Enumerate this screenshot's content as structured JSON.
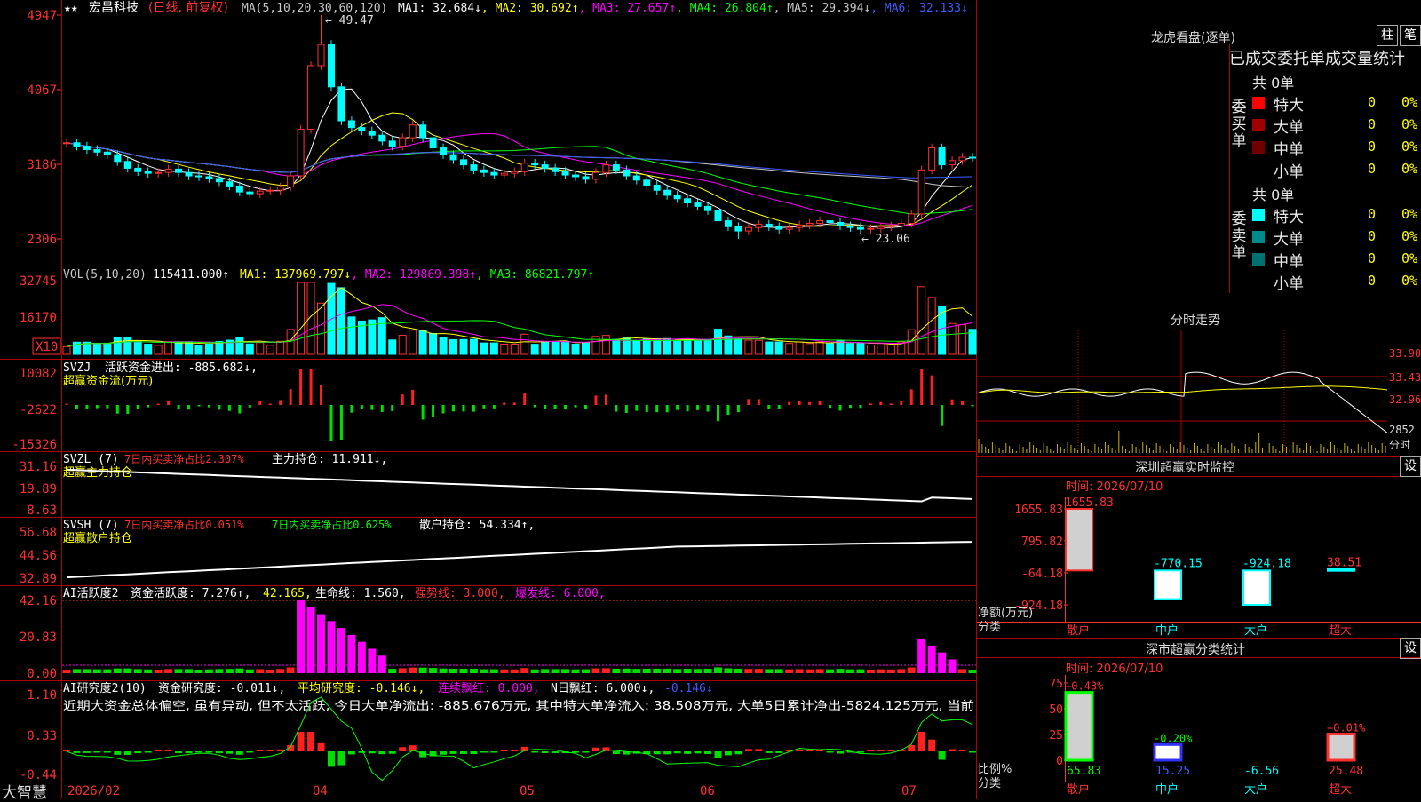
{
  "stock": {
    "name": "宏昌科技",
    "mode": "(日线, 前复权)"
  },
  "main": {
    "ma_param": "MA(5,10,20,30,60,120)",
    "ma": [
      {
        "label": "MA1: 32.684↓",
        "color": "#ffffff"
      },
      {
        "label": "MA2: 30.692↑",
        "color": "#ffff00"
      },
      {
        "label": "MA3: 27.657↑",
        "color": "#ff00ff"
      },
      {
        "label": "MA4: 26.804↑",
        "color": "#00ff00"
      },
      {
        "label": "MA5: 29.394↓",
        "color": "#c8c8c8"
      },
      {
        "label": "MA6: 32.133↓",
        "color": "#3c5cff"
      }
    ],
    "y_ticks": [
      "4947",
      "4067",
      "3186",
      "2306"
    ],
    "high_label": "49.47",
    "low_label": "23.06",
    "star_marks": "★★"
  },
  "vol": {
    "title": "VOL(5,10,20)",
    "value": "115411.000↑",
    "ma": [
      {
        "label": "MA1: 137969.797↓",
        "color": "#ffff00"
      },
      {
        "label": "MA2: 129869.398↑",
        "color": "#ff00ff"
      },
      {
        "label": "MA3: 86821.797↑",
        "color": "#00ff00"
      }
    ],
    "y_ticks": [
      "32745",
      "16170"
    ],
    "unit": "X10"
  },
  "svzj": {
    "title": "SVZJ",
    "line1": "活跃资金进出: -885.682↓,",
    "line2": "超赢资金流(万元)",
    "y_ticks": [
      "10082",
      "-2622",
      "-15326"
    ]
  },
  "svzl": {
    "title": "SVZL (7)",
    "seg1": "7日内买卖净占比2.307%",
    "seg2": "主力持仓: 11.911↓,",
    "line2": "超赢主力持仓",
    "y_ticks": [
      "31.16",
      "19.89",
      "8.63"
    ]
  },
  "svsh": {
    "title": "SVSH (7)",
    "seg1": "7日内买卖净占比0.051%",
    "seg2": "7日内买卖净占比0.625%",
    "seg3": "散户持仓: 54.334↑,",
    "line2": "超赢散户持仓",
    "y_ticks": [
      "56.68",
      "44.56",
      "32.89"
    ]
  },
  "ai1": {
    "title": "AI活跃度2",
    "seg1": "资金活跃度: 7.276↑,",
    "seg2": "42.165,",
    "seg3": "生命线: 1.560,",
    "seg4": "强势线: 3.000,",
    "seg5": "爆发线: 6.000,",
    "y_ticks": [
      "42.16",
      "20.83",
      "0.00"
    ]
  },
  "ai2": {
    "title": "AI研究度2(10)",
    "seg1": "资金研究度: -0.011↓,",
    "seg2": "平均研究度: -0.146↓,",
    "seg3": "连续飘红: 0.000,",
    "seg4": "N日飘红: 6.000↓,",
    "seg5": "-0.146↓",
    "comment": "近期大资金总体偏空, 虽有异动, 但不太活跃, 今日大单净流出: -885.676万元, 其中特大单净流入: 38.508万元, 大单5日累计净出-5824.125万元, 当前",
    "y_ticks": [
      "1.10",
      "0.33",
      "-0.44"
    ]
  },
  "x_axis": [
    "2026/02",
    "04",
    "05",
    "06",
    "07"
  ],
  "brand": "大智慧",
  "right": {
    "dragon_title": "龙虎看盘(逐单)",
    "btn_bar": "柱",
    "btn_bi": "笔",
    "order_header": "已成交委托单成交量统计",
    "buy": {
      "side": "委买单",
      "total": "共 0单",
      "rows": [
        {
          "name": "特大",
          "count": "0",
          "pct": "0%",
          "color": "#ff0000"
        },
        {
          "name": "大单",
          "count": "0",
          "pct": "0%",
          "color": "#a00000"
        },
        {
          "name": "中单",
          "count": "0",
          "pct": "0%",
          "color": "#700000"
        },
        {
          "name": "小单",
          "count": "0",
          "pct": "0%",
          "color": ""
        }
      ]
    },
    "sell": {
      "side": "委卖单",
      "total": "共 0单",
      "rows": [
        {
          "name": "特大",
          "count": "0",
          "pct": "0%",
          "color": "#00ffff"
        },
        {
          "name": "大单",
          "count": "0",
          "pct": "0%",
          "color": "#008b8b"
        },
        {
          "name": "中单",
          "count": "0",
          "pct": "0%",
          "color": "#007070"
        },
        {
          "name": "小单",
          "count": "0",
          "pct": "0%",
          "color": ""
        }
      ]
    },
    "intraday_title": "分时走势",
    "intraday_ticks": [
      "33.90",
      "33.43",
      "32.96"
    ],
    "intraday_vol_label": "2852",
    "intraday_tag": "分时",
    "monitor_title": "深圳超赢实时监控",
    "monitor_date": "时间: 2026/07/10",
    "monitor_yticks": [
      "1655.83",
      "795.82",
      "-64.18",
      "-924.18"
    ],
    "monitor_ylabel1": "净额(万元)",
    "monitor_ylabel2": "分类",
    "monitor_values": [
      {
        "label": "1655.83",
        "cat": "散户",
        "value": 1655.83
      },
      {
        "label": "-770.15",
        "cat": "中户",
        "value": -770.15
      },
      {
        "label": "-924.18",
        "cat": "大户",
        "value": -924.18
      },
      {
        "label": "38.51",
        "cat": "超大",
        "value": 38.51
      }
    ],
    "stat_title": "深市超赢分类统计",
    "stat_date": "时间: 2026/07/10",
    "stat_yticks": [
      "75",
      "50",
      "25",
      "0"
    ],
    "stat_ylabel1": "比例%",
    "stat_ylabel2": "分类",
    "stat_values": [
      {
        "top": "+0.43%",
        "bottom": "65.83",
        "cat": "散户",
        "value": 65.83
      },
      {
        "top": "-0.20%",
        "bottom": "15.25",
        "cat": "中户",
        "value": 15.25
      },
      {
        "top": "",
        "bottom": "-6.56",
        "cat": "大户",
        "value": -6.56
      },
      {
        "top": "+0.01%",
        "bottom": "25.48",
        "cat": "超大",
        "value": 25.48
      }
    ],
    "btn_set": "设"
  },
  "chart_data": {
    "type": "line",
    "title": "宏昌科技 (日线, 前复权)",
    "ylim": [
      23.06,
      49.47
    ],
    "x_ticks": [
      "2026/02",
      "04",
      "05",
      "06",
      "07"
    ],
    "close": [
      34.4,
      34.0,
      33.6,
      33.3,
      33.0,
      32.2,
      31.4,
      31.0,
      30.8,
      30.9,
      31.3,
      30.9,
      30.5,
      30.4,
      30.2,
      29.8,
      29.3,
      28.6,
      28.4,
      28.7,
      28.8,
      29.2,
      30.5,
      36.0,
      43.5,
      46.0,
      41.0,
      37.0,
      36.2,
      35.8,
      35.3,
      34.6,
      34.0,
      35.0,
      36.5,
      35.0,
      33.8,
      33.0,
      32.4,
      31.8,
      31.2,
      30.9,
      30.6,
      30.8,
      31.0,
      32.0,
      31.8,
      31.4,
      31.0,
      30.6,
      30.4,
      30.1,
      30.9,
      31.8,
      31.2,
      30.5,
      30.0,
      29.4,
      28.8,
      28.2,
      27.8,
      27.3,
      26.9,
      26.4,
      25.2,
      24.5,
      24.0,
      24.4,
      24.8,
      24.5,
      24.2,
      24.4,
      24.7,
      24.9,
      25.2,
      25.0,
      24.6,
      24.4,
      24.2,
      24.3,
      24.5,
      24.6,
      24.9,
      26.0,
      31.2,
      33.8,
      31.8,
      32.3,
      32.7,
      32.68
    ],
    "series": [
      {
        "name": "MA1",
        "last": 32.684
      },
      {
        "name": "MA2",
        "last": 30.692
      },
      {
        "name": "MA3",
        "last": 27.657
      },
      {
        "name": "MA4",
        "last": 26.804
      },
      {
        "name": "MA5",
        "last": 29.394
      },
      {
        "name": "MA6",
        "last": 32.133
      }
    ]
  }
}
